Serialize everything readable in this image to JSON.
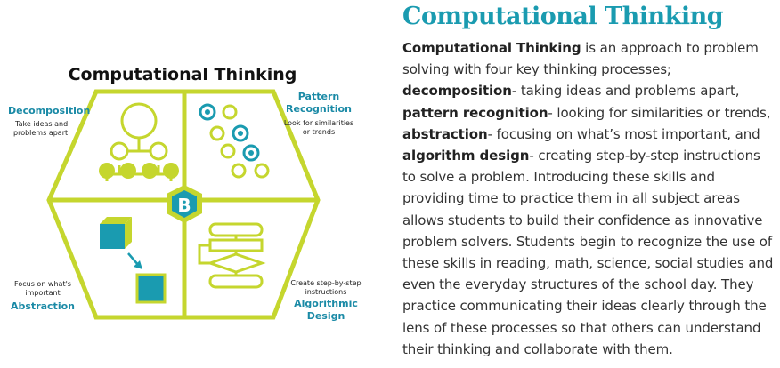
{
  "figure": {
    "title": "Computational Thinking",
    "decomposition": {
      "heading": "Decomposition",
      "desc_line1": "Take ideas and",
      "desc_line2": "problems apart"
    },
    "pattern": {
      "heading_line1": "Pattern",
      "heading_line2": "Recognition",
      "desc_line1": "Look for similarities",
      "desc_line2": "or trends"
    },
    "abstraction": {
      "desc_line1": "Focus on what's",
      "desc_line2": "important",
      "heading": "Abstraction"
    },
    "algorithm": {
      "desc_line1": "Create step-by-step",
      "desc_line2": "instructions",
      "heading_line1": "Algorithmic",
      "heading_line2": "Design"
    },
    "center_letter": "B",
    "colors": {
      "lime": "#c5d62e",
      "teal": "#1a9bb0",
      "accent_text": "#1a8aa6"
    }
  },
  "article": {
    "title": "Computational Thinking",
    "segments": [
      {
        "text": "Computational Thinking",
        "bold": true
      },
      {
        "text": " is an approach to problem solving with four key thinking processes; ",
        "bold": false
      },
      {
        "text": "decomposition",
        "bold": true
      },
      {
        "text": "- taking ideas and problems apart, ",
        "bold": false
      },
      {
        "text": "pattern recognition",
        "bold": true
      },
      {
        "text": "- looking for similarities or trends, ",
        "bold": false
      },
      {
        "text": "abstraction",
        "bold": true
      },
      {
        "text": "- focusing on what’s most important, and ",
        "bold": false
      },
      {
        "text": "algorithm design",
        "bold": true
      },
      {
        "text": "- creating step-by-step instructions to solve a problem. Introducing these skills and providing time to practice them in all subject areas allows students to build their confidence as innovative problem solvers. Students begin to recognize the use of these skills in reading, math, science, social studies and even the everyday structures of the school day. They practice communicating their ideas clearly through the lens of these processes so that others can understand their thinking and collaborate with them.",
        "bold": false
      }
    ]
  }
}
